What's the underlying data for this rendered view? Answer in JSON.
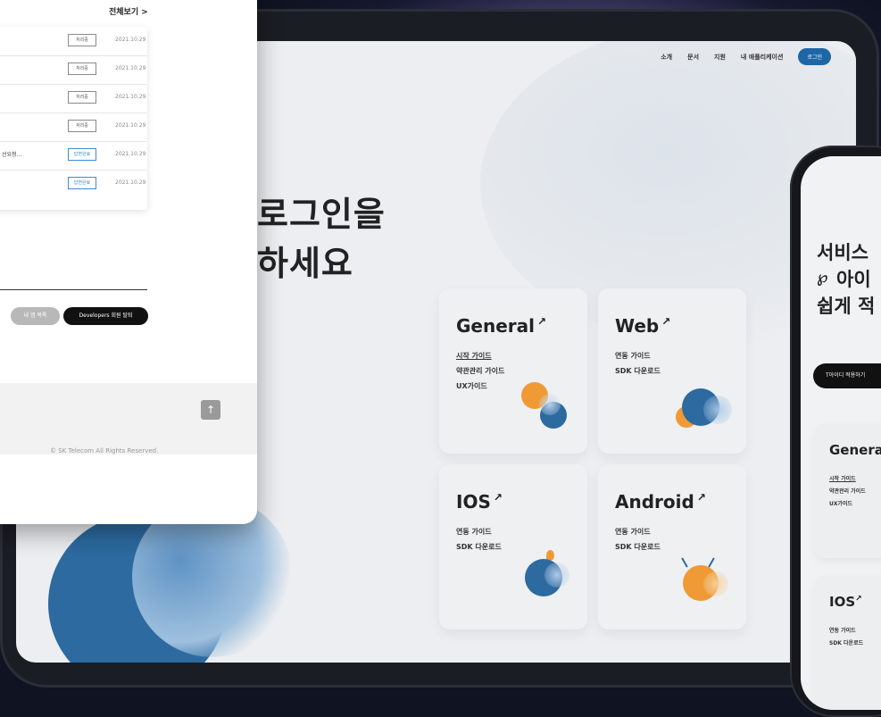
{
  "panel": {
    "see_all": "전체보기 >",
    "rows": [
      {
        "title": "",
        "status": "처리중",
        "date": "2021.10.29",
        "status_color": "#8a8a8a"
      },
      {
        "title": "",
        "status": "처리중",
        "date": "2021.10.29",
        "status_color": "#8a8a8a"
      },
      {
        "title": "",
        "status": "처리중",
        "date": "2021.10.29",
        "status_color": "#8a8a8a"
      },
      {
        "title": "",
        "status": "처리중",
        "date": "2021.10.29",
        "status_color": "#8a8a8a"
      },
      {
        "title": "선요청...",
        "status": "답변완료",
        "date": "2021.10.29",
        "status_color": "#3f8bd3"
      },
      {
        "title": "",
        "status": "답변완료",
        "date": "2021.10.29",
        "status_color": "#3f8bd3"
      }
    ],
    "my_app_list_button": "내 앱 목록",
    "withdraw_button": "Developers 회원 탈퇴",
    "scroll_top_icon": "arrow-up-icon",
    "copyright": "© SK Telecom All Rights Reserved."
  },
  "tablet": {
    "nav": [
      "소개",
      "문서",
      "지원",
      "내 애플리케이션"
    ],
    "login_button": "로그인",
    "headline_line1": "로그인을",
    "headline_line2": "하세요",
    "cards": [
      {
        "title": "General",
        "links": [
          "시작 가이드",
          "약관관리 가이드",
          "UX가이드"
        ]
      },
      {
        "title": "Web",
        "links": [
          "연동 가이드",
          "SDK 다운로드"
        ]
      },
      {
        "title": "IOS",
        "links": [
          "연동 가이드",
          "SDK 다운로드"
        ]
      },
      {
        "title": "Android",
        "links": [
          "연동 가이드",
          "SDK 다운로드"
        ]
      }
    ],
    "card_arrow": "↗",
    "accent_color": "#1f66a6",
    "orange_color": "#ef9a35"
  },
  "phone": {
    "title_line1": "서비스",
    "title_line2": "아이",
    "title_line3": "쉽게 적",
    "cta_button": "T아이디 적용하기",
    "cards": [
      {
        "title": "Genera",
        "links": [
          "시작 가이드",
          "약관관리 가이드",
          "UX가이드"
        ]
      },
      {
        "title": "IOS",
        "links": [
          "연동 가이드",
          "SDK 다운로드"
        ]
      }
    ]
  }
}
